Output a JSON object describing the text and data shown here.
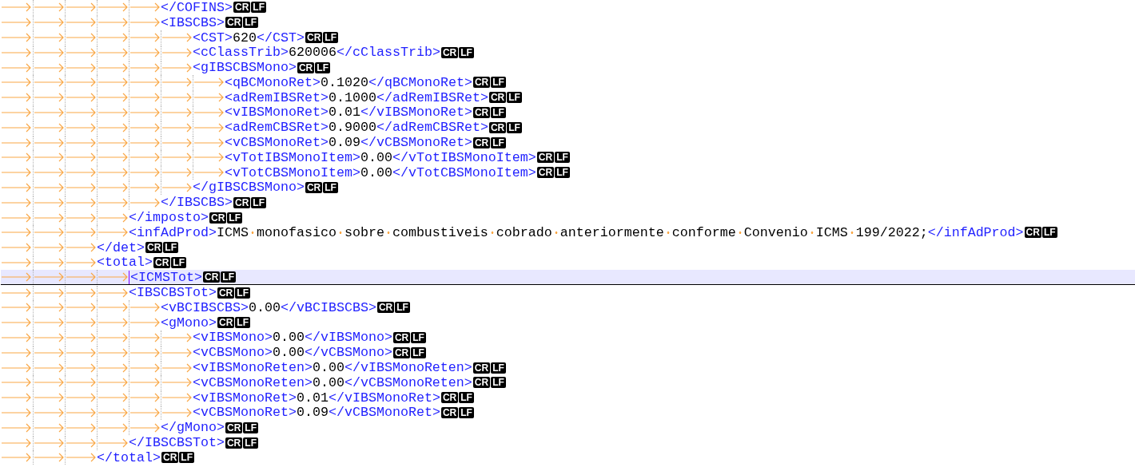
{
  "nodes": [
    {
      "kind": "element",
      "close_tag": "</det>",
      "close_eol": [
        "CR",
        "LF"
      ],
      "children": [
        {
          "kind": "element",
          "close_tag": "</imposto>",
          "close_eol": [
            "CR",
            "LF"
          ],
          "children": [
            {
              "kind": "element",
              "close_tag": "</COFINS>",
              "close_eol": [
                "CR",
                "LF"
              ]
            },
            {
              "kind": "element",
              "open_tag": "<IBSCBS>",
              "open_eol": [
                "CR",
                "LF"
              ],
              "close_tag": "</IBSCBS>",
              "close_eol": [
                "CR",
                "LF"
              ],
              "children": [
                {
                  "kind": "leaf",
                  "open_tag": "<CST>",
                  "value": "620",
                  "close_tag": "</CST>",
                  "eol": [
                    "CR",
                    "LF"
                  ]
                },
                {
                  "kind": "leaf",
                  "open_tag": "<cClassTrib>",
                  "value": "620006",
                  "close_tag": "</cClassTrib>",
                  "eol": [
                    "CR",
                    "LF"
                  ]
                },
                {
                  "kind": "element",
                  "open_tag": "<gIBSCBSMono>",
                  "open_eol": [
                    "CR",
                    "LF"
                  ],
                  "close_tag": "</gIBSCBSMono>",
                  "close_eol": [
                    "CR",
                    "LF"
                  ],
                  "children": [
                    {
                      "kind": "leaf",
                      "open_tag": "<qBCMonoRet>",
                      "value": "0.1020",
                      "close_tag": "</qBCMonoRet>",
                      "eol": [
                        "CR",
                        "LF"
                      ]
                    },
                    {
                      "kind": "leaf",
                      "open_tag": "<adRemIBSRet>",
                      "value": "0.1000",
                      "close_tag": "</adRemIBSRet>",
                      "eol": [
                        "CR",
                        "LF"
                      ]
                    },
                    {
                      "kind": "leaf",
                      "open_tag": "<vIBSMonoRet>",
                      "value": "0.01",
                      "close_tag": "</vIBSMonoRet>",
                      "eol": [
                        "CR",
                        "LF"
                      ]
                    },
                    {
                      "kind": "leaf",
                      "open_tag": "<adRemCBSRet>",
                      "value": "0.9000",
                      "close_tag": "</adRemCBSRet>",
                      "eol": [
                        "CR",
                        "LF"
                      ]
                    },
                    {
                      "kind": "leaf",
                      "open_tag": "<vCBSMonoRet>",
                      "value": "0.09",
                      "close_tag": "</vCBSMonoRet>",
                      "eol": [
                        "CR",
                        "LF"
                      ]
                    },
                    {
                      "kind": "leaf",
                      "open_tag": "<vTotIBSMonoItem>",
                      "value": "0.00",
                      "close_tag": "</vTotIBSMonoItem>",
                      "eol": [
                        "CR",
                        "LF"
                      ]
                    },
                    {
                      "kind": "leaf",
                      "open_tag": "<vTotCBSMonoItem>",
                      "value": "0.00",
                      "close_tag": "</vTotCBSMonoItem>",
                      "eol": [
                        "CR",
                        "LF"
                      ]
                    }
                  ]
                }
              ]
            }
          ]
        },
        {
          "kind": "leaf",
          "open_tag": "<infAdProd>",
          "value": "ICMS monofasico sobre combustiveis cobrado anteriormente conforme Convenio ICMS 199/2022;",
          "close_tag": "</infAdProd>",
          "eol": [
            "CR",
            "LF"
          ]
        }
      ]
    },
    {
      "kind": "element",
      "open_tag": "<total>",
      "open_eol": [
        "CR",
        "LF"
      ],
      "close_tag": "</total>",
      "close_eol": [
        "CR",
        "LF"
      ],
      "children": [
        {
          "kind": "folded",
          "open_tag": "<ICMSTot>",
          "eol": [
            "CR",
            "LF"
          ],
          "caret": true
        },
        {
          "kind": "element",
          "open_tag": "<IBSCBSTot>",
          "open_eol": [
            "CR",
            "LF"
          ],
          "close_tag": "</IBSCBSTot>",
          "close_eol": [
            "CR",
            "LF"
          ],
          "children": [
            {
              "kind": "leaf",
              "open_tag": "<vBCIBSCBS>",
              "value": "0.00",
              "close_tag": "</vBCIBSCBS>",
              "eol": [
                "CR",
                "LF"
              ]
            },
            {
              "kind": "element",
              "open_tag": "<gMono>",
              "open_eol": [
                "CR",
                "LF"
              ],
              "close_tag": "</gMono>",
              "close_eol": [
                "CR",
                "LF"
              ],
              "children": [
                {
                  "kind": "leaf",
                  "open_tag": "<vIBSMono>",
                  "value": "0.00",
                  "close_tag": "</vIBSMono>",
                  "eol": [
                    "CR",
                    "LF"
                  ]
                },
                {
                  "kind": "leaf",
                  "open_tag": "<vCBSMono>",
                  "value": "0.00",
                  "close_tag": "</vCBSMono>",
                  "eol": [
                    "CR",
                    "LF"
                  ]
                },
                {
                  "kind": "leaf",
                  "open_tag": "<vIBSMonoReten>",
                  "value": "0.00",
                  "close_tag": "</vIBSMonoReten>",
                  "eol": [
                    "CR",
                    "LF"
                  ]
                },
                {
                  "kind": "leaf",
                  "open_tag": "<vCBSMonoReten>",
                  "value": "0.00",
                  "close_tag": "</vCBSMonoReten>",
                  "eol": [
                    "CR",
                    "LF"
                  ]
                },
                {
                  "kind": "leaf",
                  "open_tag": "<vIBSMonoRet>",
                  "value": "0.01",
                  "close_tag": "</vIBSMonoRet>",
                  "eol": [
                    "CR",
                    "LF"
                  ]
                },
                {
                  "kind": "leaf",
                  "open_tag": "<vCBSMonoRet>",
                  "value": "0.09",
                  "close_tag": "</vCBSMonoRet>",
                  "eol": [
                    "CR",
                    "LF"
                  ]
                }
              ]
            }
          ]
        }
      ]
    }
  ]
}
